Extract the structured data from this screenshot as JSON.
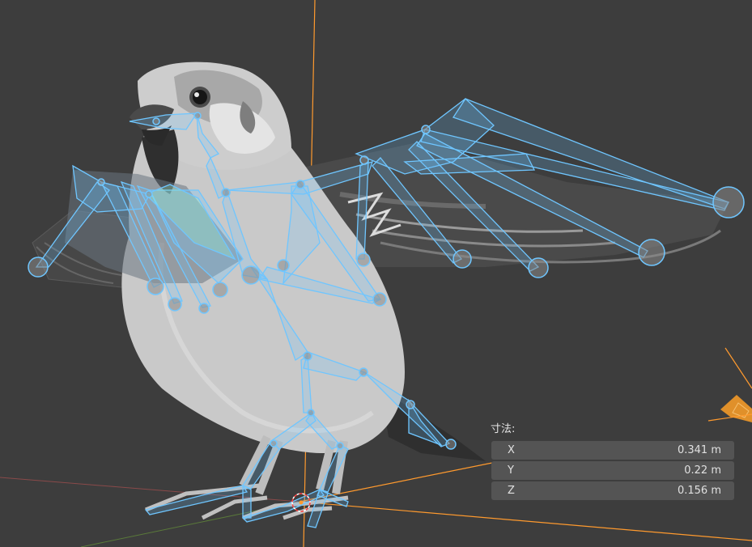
{
  "viewport": {
    "background": "#3d3d3d",
    "bone_color": "#6fc6ff",
    "axis_z_color": "#ff9a2e"
  },
  "dimensions": {
    "title": "寸法:",
    "rows": [
      {
        "axis": "X",
        "value": "0.341 m"
      },
      {
        "axis": "Y",
        "value": "0.22 m"
      },
      {
        "axis": "Z",
        "value": "0.156 m"
      }
    ]
  }
}
